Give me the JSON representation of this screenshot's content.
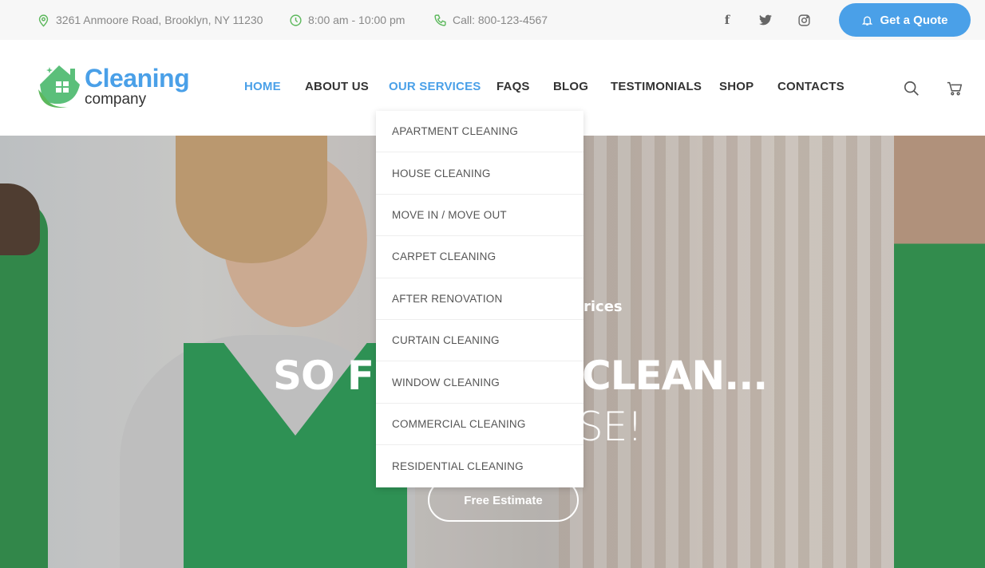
{
  "topbar": {
    "address": "3261 Anmoore Road, Brooklyn, NY 11230",
    "hours": "8:00 am - 10:00 pm",
    "phone": "Call: 800-123-4567",
    "social": [
      "facebook-icon",
      "twitter-icon",
      "instagram-icon"
    ],
    "quote_label": "Get a Quote"
  },
  "logo": {
    "word": "Cleaning",
    "sub": "company"
  },
  "nav": [
    {
      "label": "HOME",
      "active": true
    },
    {
      "label": "ABOUT US"
    },
    {
      "label": "OUR SERVICES",
      "active": true
    },
    {
      "label": "FAQS"
    },
    {
      "label": "BLOG"
    },
    {
      "label": "TESTIMONIALS"
    },
    {
      "label": "SHOP"
    },
    {
      "label": "CONTACTS"
    }
  ],
  "dropdown": [
    "APARTMENT CLEANING",
    "HOUSE CLEANING",
    "MOVE IN / MOVE OUT",
    "CARPET CLEANING",
    "AFTER RENOVATION",
    "CURTAIN CLEANING",
    "WINDOW CLEANING",
    "COMMERCIAL CLEANING",
    "RESIDENTIAL CLEANING"
  ],
  "hero": {
    "subtitle_fragment": "rices",
    "title_left": "SO FR",
    "title_right": "CLEAN...",
    "line2_fragment": "SE!",
    "button": "Free Estimate"
  },
  "colors": {
    "accent": "#4aa0e8",
    "green": "#5cb85c"
  }
}
